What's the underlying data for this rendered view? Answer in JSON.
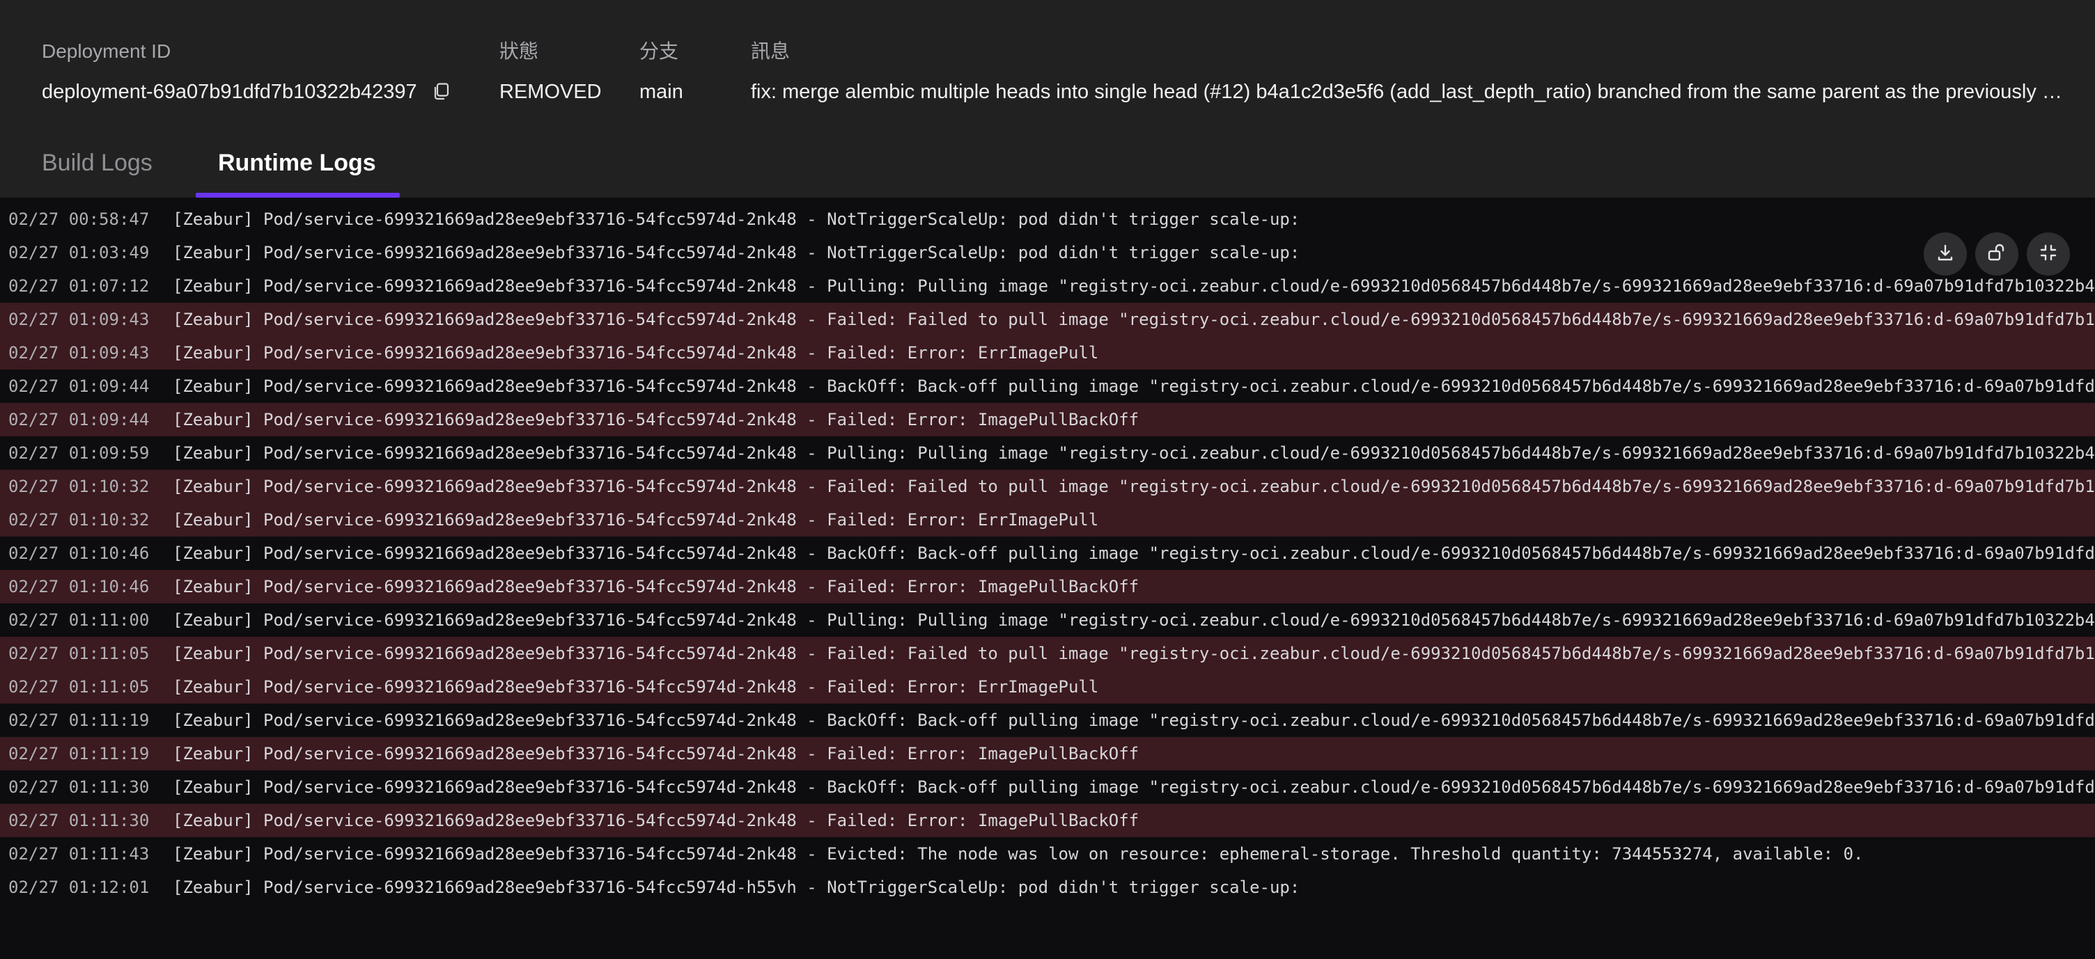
{
  "deployment": {
    "id_label": "Deployment ID",
    "id_value": "deployment-69a07b91dfd7b10322b42397",
    "status_label": "狀態",
    "status_value": "REMOVED",
    "branch_label": "分支",
    "branch_value": "main",
    "message_label": "訊息",
    "message_value": "fix: merge alembic multiple heads into single head (#12) b4a1c2d3e5f6 (add_last_depth_ratio) branched from the same parent as the previously …"
  },
  "tabs": [
    {
      "label": "Build Logs",
      "active": false
    },
    {
      "label": "Runtime Logs",
      "active": true
    }
  ],
  "toolbar": {
    "download_icon": "download-icon",
    "unlock_icon": "unlock-icon",
    "collapse_icon": "collapse-icon"
  },
  "colors": {
    "accent": "#6a35f0",
    "error_row": "#3b1a20",
    "header_bg": "#212122",
    "log_bg": "#0d0d0f"
  },
  "logs": [
    {
      "ts": "02/27 00:58:47",
      "msg": "[Zeabur] Pod/service-699321669ad28ee9ebf33716-54fcc5974d-2nk48 - NotTriggerScaleUp: pod didn't trigger scale-up:",
      "level": "info"
    },
    {
      "ts": "02/27 01:03:49",
      "msg": "[Zeabur] Pod/service-699321669ad28ee9ebf33716-54fcc5974d-2nk48 - NotTriggerScaleUp: pod didn't trigger scale-up:",
      "level": "info"
    },
    {
      "ts": "02/27 01:07:12",
      "msg": "[Zeabur] Pod/service-699321669ad28ee9ebf33716-54fcc5974d-2nk48 - Pulling: Pulling image \"registry-oci.zeabur.cloud/e-6993210d0568457b6d448b7e/s-699321669ad28ee9ebf33716:d-69a07b91dfd7b10322b4",
      "level": "info"
    },
    {
      "ts": "02/27 01:09:43",
      "msg": "[Zeabur] Pod/service-699321669ad28ee9ebf33716-54fcc5974d-2nk48 - Failed: Failed to pull image \"registry-oci.zeabur.cloud/e-6993210d0568457b6d448b7e/s-699321669ad28ee9ebf33716:d-69a07b91dfd7b1",
      "level": "error"
    },
    {
      "ts": "02/27 01:09:43",
      "msg": "[Zeabur] Pod/service-699321669ad28ee9ebf33716-54fcc5974d-2nk48 - Failed: Error: ErrImagePull",
      "level": "error"
    },
    {
      "ts": "02/27 01:09:44",
      "msg": "[Zeabur] Pod/service-699321669ad28ee9ebf33716-54fcc5974d-2nk48 - BackOff: Back-off pulling image \"registry-oci.zeabur.cloud/e-6993210d0568457b6d448b7e/s-699321669ad28ee9ebf33716:d-69a07b91dfd",
      "level": "info"
    },
    {
      "ts": "02/27 01:09:44",
      "msg": "[Zeabur] Pod/service-699321669ad28ee9ebf33716-54fcc5974d-2nk48 - Failed: Error: ImagePullBackOff",
      "level": "error"
    },
    {
      "ts": "02/27 01:09:59",
      "msg": "[Zeabur] Pod/service-699321669ad28ee9ebf33716-54fcc5974d-2nk48 - Pulling: Pulling image \"registry-oci.zeabur.cloud/e-6993210d0568457b6d448b7e/s-699321669ad28ee9ebf33716:d-69a07b91dfd7b10322b4",
      "level": "info"
    },
    {
      "ts": "02/27 01:10:32",
      "msg": "[Zeabur] Pod/service-699321669ad28ee9ebf33716-54fcc5974d-2nk48 - Failed: Failed to pull image \"registry-oci.zeabur.cloud/e-6993210d0568457b6d448b7e/s-699321669ad28ee9ebf33716:d-69a07b91dfd7b1",
      "level": "error"
    },
    {
      "ts": "02/27 01:10:32",
      "msg": "[Zeabur] Pod/service-699321669ad28ee9ebf33716-54fcc5974d-2nk48 - Failed: Error: ErrImagePull",
      "level": "error"
    },
    {
      "ts": "02/27 01:10:46",
      "msg": "[Zeabur] Pod/service-699321669ad28ee9ebf33716-54fcc5974d-2nk48 - BackOff: Back-off pulling image \"registry-oci.zeabur.cloud/e-6993210d0568457b6d448b7e/s-699321669ad28ee9ebf33716:d-69a07b91dfd",
      "level": "info"
    },
    {
      "ts": "02/27 01:10:46",
      "msg": "[Zeabur] Pod/service-699321669ad28ee9ebf33716-54fcc5974d-2nk48 - Failed: Error: ImagePullBackOff",
      "level": "error"
    },
    {
      "ts": "02/27 01:11:00",
      "msg": "[Zeabur] Pod/service-699321669ad28ee9ebf33716-54fcc5974d-2nk48 - Pulling: Pulling image \"registry-oci.zeabur.cloud/e-6993210d0568457b6d448b7e/s-699321669ad28ee9ebf33716:d-69a07b91dfd7b10322b4",
      "level": "info"
    },
    {
      "ts": "02/27 01:11:05",
      "msg": "[Zeabur] Pod/service-699321669ad28ee9ebf33716-54fcc5974d-2nk48 - Failed: Failed to pull image \"registry-oci.zeabur.cloud/e-6993210d0568457b6d448b7e/s-699321669ad28ee9ebf33716:d-69a07b91dfd7b1",
      "level": "error"
    },
    {
      "ts": "02/27 01:11:05",
      "msg": "[Zeabur] Pod/service-699321669ad28ee9ebf33716-54fcc5974d-2nk48 - Failed: Error: ErrImagePull",
      "level": "error"
    },
    {
      "ts": "02/27 01:11:19",
      "msg": "[Zeabur] Pod/service-699321669ad28ee9ebf33716-54fcc5974d-2nk48 - BackOff: Back-off pulling image \"registry-oci.zeabur.cloud/e-6993210d0568457b6d448b7e/s-699321669ad28ee9ebf33716:d-69a07b91dfd",
      "level": "info"
    },
    {
      "ts": "02/27 01:11:19",
      "msg": "[Zeabur] Pod/service-699321669ad28ee9ebf33716-54fcc5974d-2nk48 - Failed: Error: ImagePullBackOff",
      "level": "error"
    },
    {
      "ts": "02/27 01:11:30",
      "msg": "[Zeabur] Pod/service-699321669ad28ee9ebf33716-54fcc5974d-2nk48 - BackOff: Back-off pulling image \"registry-oci.zeabur.cloud/e-6993210d0568457b6d448b7e/s-699321669ad28ee9ebf33716:d-69a07b91dfd",
      "level": "info"
    },
    {
      "ts": "02/27 01:11:30",
      "msg": "[Zeabur] Pod/service-699321669ad28ee9ebf33716-54fcc5974d-2nk48 - Failed: Error: ImagePullBackOff",
      "level": "error"
    },
    {
      "ts": "02/27 01:11:43",
      "msg": "[Zeabur] Pod/service-699321669ad28ee9ebf33716-54fcc5974d-2nk48 - Evicted: The node was low on resource: ephemeral-storage. Threshold quantity: 7344553274, available: 0.",
      "level": "info"
    },
    {
      "ts": "02/27 01:12:01",
      "msg": "[Zeabur] Pod/service-699321669ad28ee9ebf33716-54fcc5974d-h55vh - NotTriggerScaleUp: pod didn't trigger scale-up:",
      "level": "info"
    }
  ]
}
